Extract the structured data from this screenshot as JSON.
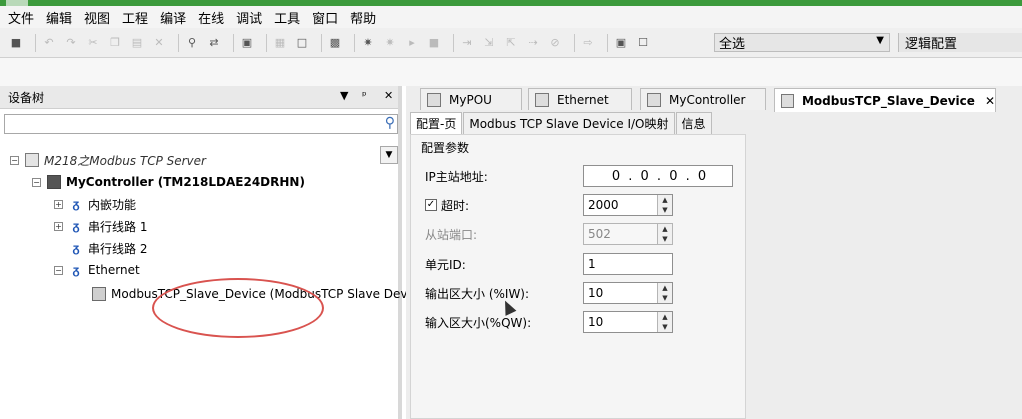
{
  "menu": [
    "文件",
    "编辑",
    "视图",
    "工程",
    "编译",
    "在线",
    "调试",
    "工具",
    "窗口",
    "帮助"
  ],
  "toolbar": {
    "select_value": "全选",
    "logic_config": "逻辑配置"
  },
  "device_tree": {
    "title": "设备树",
    "controls": [
      "▼",
      "ᵖ",
      "✕"
    ],
    "root": "M218之Modbus TCP Server",
    "controller": "MyController (TM218LDAE24DRHN)",
    "items": [
      "内嵌功能",
      "串行线路 1",
      "串行线路 2",
      "Ethernet"
    ],
    "slave": "ModbusTCP_Slave_Device (ModbusTCP Slave Device)"
  },
  "editor_tabs": [
    "MyPOU",
    "Ethernet",
    "MyController",
    "ModbusTCP_Slave_Device"
  ],
  "sub_tabs": [
    "配置-页",
    "Modbus TCP Slave Device I/O映射",
    "信息"
  ],
  "config": {
    "section_title": "配置参数",
    "ip_label": "IP主站地址:",
    "ip_value": "0 . 0 . 0 . 0",
    "timeout_label": "超时:",
    "timeout_value": "2000",
    "port_label": "从站端口:",
    "port_value": "502",
    "unit_label": "单元ID:",
    "unit_value": "1",
    "out_label": "输出区大小 (%IW):",
    "out_value": "10",
    "in_label": "输入区大小(%QW):",
    "in_value": "10"
  }
}
